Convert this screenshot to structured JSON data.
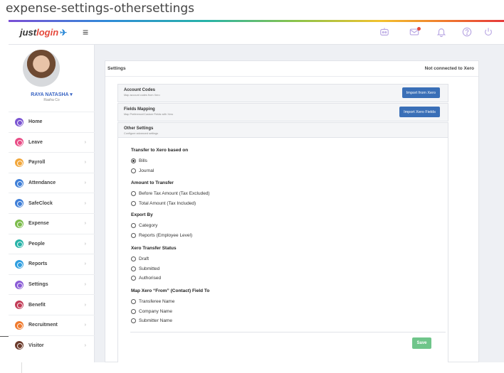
{
  "caption": "expense-settings-othersettings",
  "brand": {
    "part1": "just",
    "part2": "login",
    "colors": {
      "accent": "#3a6fb7",
      "save": "#6fc58a",
      "logo_red": "#e5483b"
    }
  },
  "topbar_icons": [
    "robot-icon",
    "mail-icon",
    "bell-icon",
    "help-icon",
    "power-icon"
  ],
  "user": {
    "name": "RAYA NATASHA ▾",
    "company": "Rasha Co"
  },
  "sidebar": {
    "items": [
      {
        "label": "Home",
        "color": "#7b55d2",
        "chevron": ""
      },
      {
        "label": "Leave",
        "color": "#e94c86",
        "chevron": "›"
      },
      {
        "label": "Payroll",
        "color": "#f2a73b",
        "chevron": "›"
      },
      {
        "label": "Attendance",
        "color": "#3f7fd8",
        "chevron": "›"
      },
      {
        "label": "SafeClock",
        "color": "#3f7fd8",
        "chevron": "›"
      },
      {
        "label": "Expense",
        "color": "#7cbc4b",
        "chevron": "›"
      },
      {
        "label": "People",
        "color": "#27b3a8",
        "chevron": "›"
      },
      {
        "label": "Reports",
        "color": "#2f9ee0",
        "chevron": "›"
      },
      {
        "label": "Settings",
        "color": "#8a5bd6",
        "chevron": "›"
      },
      {
        "label": "Benefit",
        "color": "#c23b56",
        "chevron": "›"
      },
      {
        "label": "Recruitment",
        "color": "#f07a2e",
        "chevron": "›"
      },
      {
        "label": "Visitor",
        "color": "#6b3a2a",
        "chevron": "›"
      }
    ]
  },
  "panel": {
    "title": "Settings",
    "xero_status": "Not connected to Xero"
  },
  "sections": {
    "account_codes": {
      "title": "Account Codes",
      "subtitle": "Map account codes from Xero",
      "button": "Import from Xero"
    },
    "fields_mapping": {
      "title": "Fields Mapping",
      "subtitle": "Map Preference/Custom Fields with Xero",
      "button": "Import Xero Fields"
    },
    "other_settings": {
      "title": "Other Settings",
      "subtitle": "Configure advanced settings"
    }
  },
  "groups": {
    "transfer": {
      "title": "Transfer to Xero based on",
      "options": [
        "Bills",
        "Journal"
      ],
      "selected": "Bills"
    },
    "amount": {
      "title": "Amount to Transfer",
      "options": [
        "Before Tax Amount (Tax Excluded)",
        "Total Amount (Tax Included)"
      ]
    },
    "export": {
      "title": "Export By",
      "options": [
        "Category",
        "Reports (Employee Level)"
      ]
    },
    "status": {
      "title": "Xero Transfer Status",
      "options": [
        "Draft",
        "Submitted",
        "Authorised"
      ]
    },
    "map_from": {
      "title": "Map Xero “From” (Contact) Field To",
      "options": [
        "Transferee Name",
        "Company Name",
        "Submitter Name"
      ]
    }
  },
  "save_label": "Save"
}
